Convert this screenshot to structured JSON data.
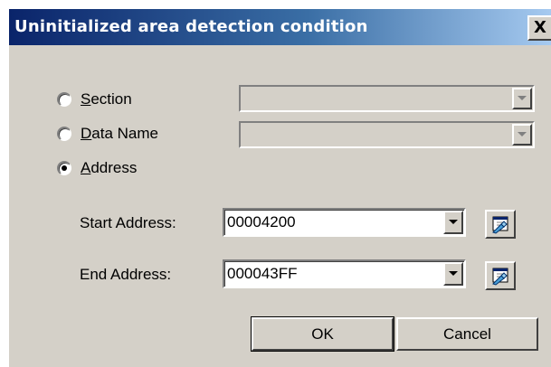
{
  "window": {
    "title": "Uninitialized area detection condition",
    "close_glyph": "X"
  },
  "radios": [
    {
      "mnemonic": "S",
      "rest": "ection",
      "checked": false
    },
    {
      "mnemonic": "D",
      "rest": "ata Name",
      "checked": false
    },
    {
      "mnemonic": "A",
      "rest": "ddress",
      "checked": true
    }
  ],
  "section_combo": {
    "value": "",
    "enabled": false
  },
  "data_name_combo": {
    "value": "",
    "enabled": false
  },
  "start_address": {
    "label": "Start Address:",
    "value": "00004200"
  },
  "end_address": {
    "label": "End Address:",
    "value": "000043FF"
  },
  "buttons": {
    "ok": "OK",
    "cancel": "Cancel"
  },
  "icons": {
    "combo_arrow": "chevron-down-icon",
    "browse": "browse-symbol-icon",
    "radio_checked": "radio-checked-icon",
    "radio_unchecked": "radio-unchecked-icon"
  },
  "colors": {
    "title_gradient_start": "#0a246a",
    "title_gradient_end": "#a6caf0",
    "dialog_bg": "#d4d0c8"
  }
}
